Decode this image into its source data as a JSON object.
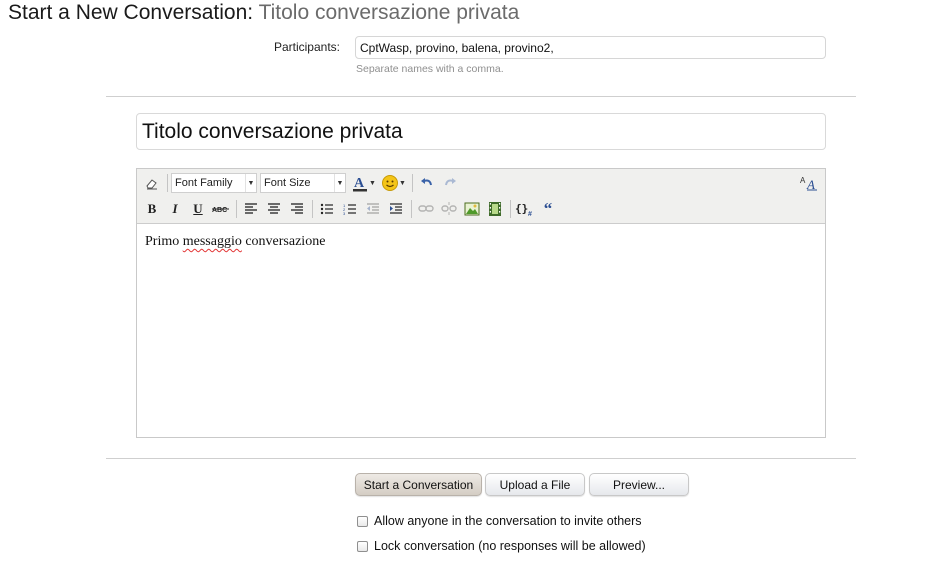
{
  "header": {
    "title": "Start a New Conversation:",
    "subtitle": "Titolo conversazione privata"
  },
  "participants": {
    "label": "Participants:",
    "value": "CptWasp, provino, balena, provino2,",
    "hint": "Separate names with a comma."
  },
  "conversation_title": {
    "value": "Titolo conversazione privata"
  },
  "editor": {
    "toolbar": {
      "font_family": "Font Family",
      "font_size": "Font Size",
      "row1_icons": [
        "eraser-icon",
        "font-color-icon",
        "smiley-icon",
        "undo-icon",
        "redo-icon",
        "toggle-font-size-icon"
      ],
      "row2_icons": [
        "bold-icon",
        "italic-icon",
        "underline-icon",
        "strikethrough-icon",
        "align-left-icon",
        "align-center-icon",
        "align-right-icon",
        "bullet-list-icon",
        "numbered-list-icon",
        "outdent-icon",
        "indent-icon",
        "link-icon",
        "unlink-icon",
        "image-icon",
        "media-icon",
        "code-icon",
        "quote-icon"
      ]
    },
    "content_parts": [
      "Primo ",
      "messaggio",
      " conversazione"
    ]
  },
  "actions": {
    "start_label": "Start a Conversation",
    "upload_label": "Upload a File",
    "preview_label": "Preview..."
  },
  "options": {
    "invite_label": "Allow anyone in the conversation to invite others",
    "lock_label": "Lock conversation (no responses will be allowed)"
  },
  "colors": {
    "accent_link": "#3a62a8",
    "divider": "#cfcfcf"
  }
}
